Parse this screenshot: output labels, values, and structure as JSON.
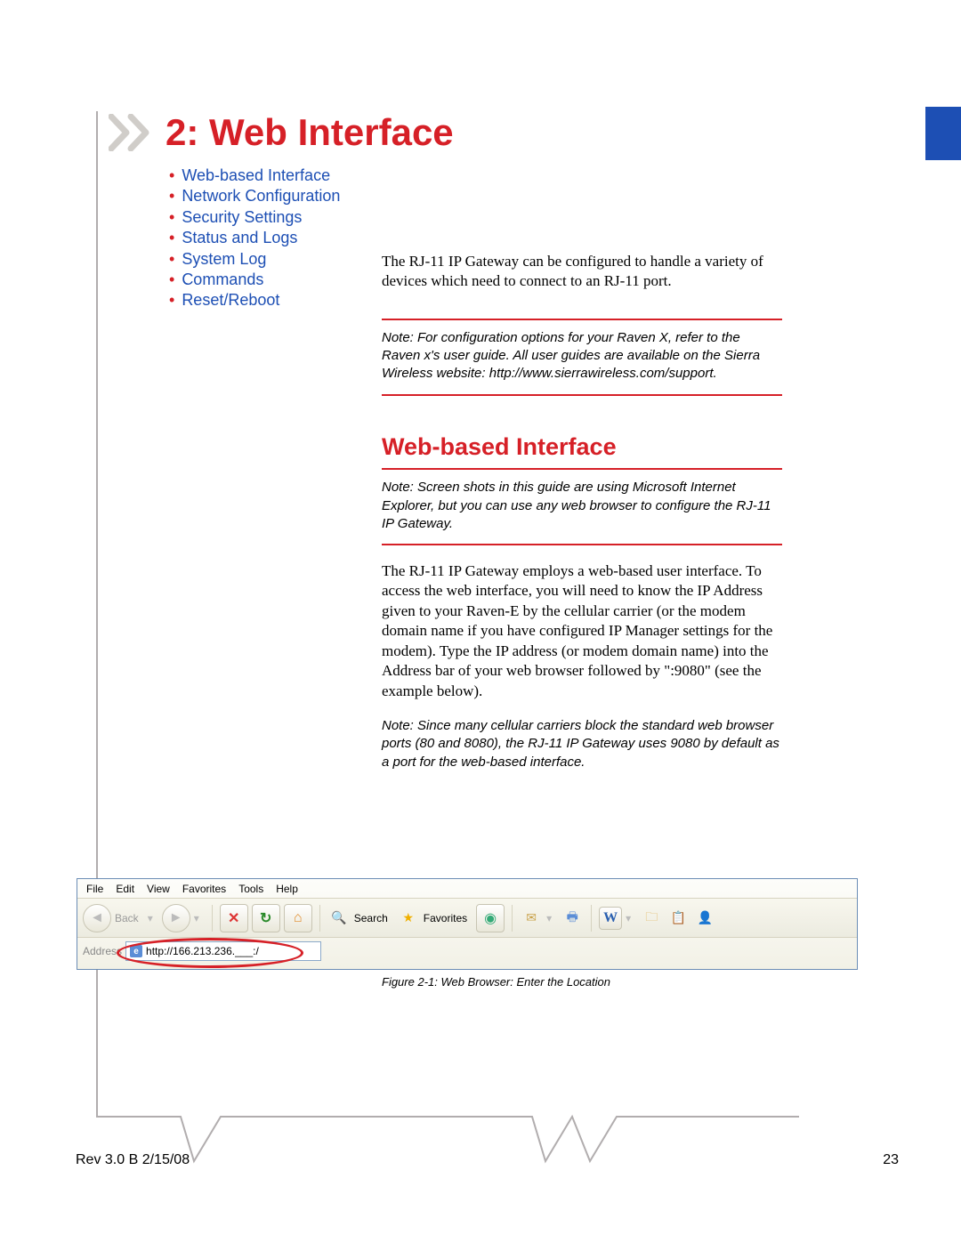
{
  "chapter": {
    "title": "2: Web Interface"
  },
  "toc": {
    "items": [
      {
        "label": "Web-based Interface"
      },
      {
        "label": "Network Configuration"
      },
      {
        "label": "Security Settings"
      },
      {
        "label": "Status and Logs"
      },
      {
        "label": "System Log"
      },
      {
        "label": "Commands"
      },
      {
        "label": "Reset/Reboot"
      }
    ]
  },
  "body": {
    "intro": "The  RJ-11 IP Gateway can be configured to handle a variety of devices which need to connect to an RJ-11 port.",
    "note1": "Note:  For configuration options for your Raven X, refer to the Raven x's user guide. All user guides are available on the Sierra Wireless website: http://www.sierrawireless.com/support.",
    "h2": "Web-based Interface",
    "note2": "Note:   Screen shots in this guide are using Microsoft Internet Explorer, but you can use any web browser to configure the  RJ-11 IP Gateway.",
    "para2": "The  RJ-11 IP Gateway employs a web-based user interface. To access the web interface, you will need to know the IP Address given to your Raven-E by the cellular carrier (or the modem domain name if you have configured IP Manager settings for the modem). Type the IP address (or modem domain name) into the Address bar of your web browser followed by \":9080\" (see the example below).",
    "note3": "Note: Since many cellular carriers block the standard web browser ports (80 and 8080), the  RJ-11 IP Gateway uses 9080 by default as a port for the web-based interface."
  },
  "figure": {
    "menu": {
      "file": "File",
      "edit": "Edit",
      "view": "View",
      "favorites": "Favorites",
      "tools": "Tools",
      "help": "Help"
    },
    "toolbar": {
      "back": "Back",
      "search": "Search",
      "favorites": "Favorites"
    },
    "address_label": "Address",
    "address_value": "http://166.213.236.___:/",
    "caption": "Figure 2-1:  Web Browser: Enter the Location"
  },
  "footer": {
    "left": "Rev 3.0 B  2/15/08",
    "right": "23"
  }
}
